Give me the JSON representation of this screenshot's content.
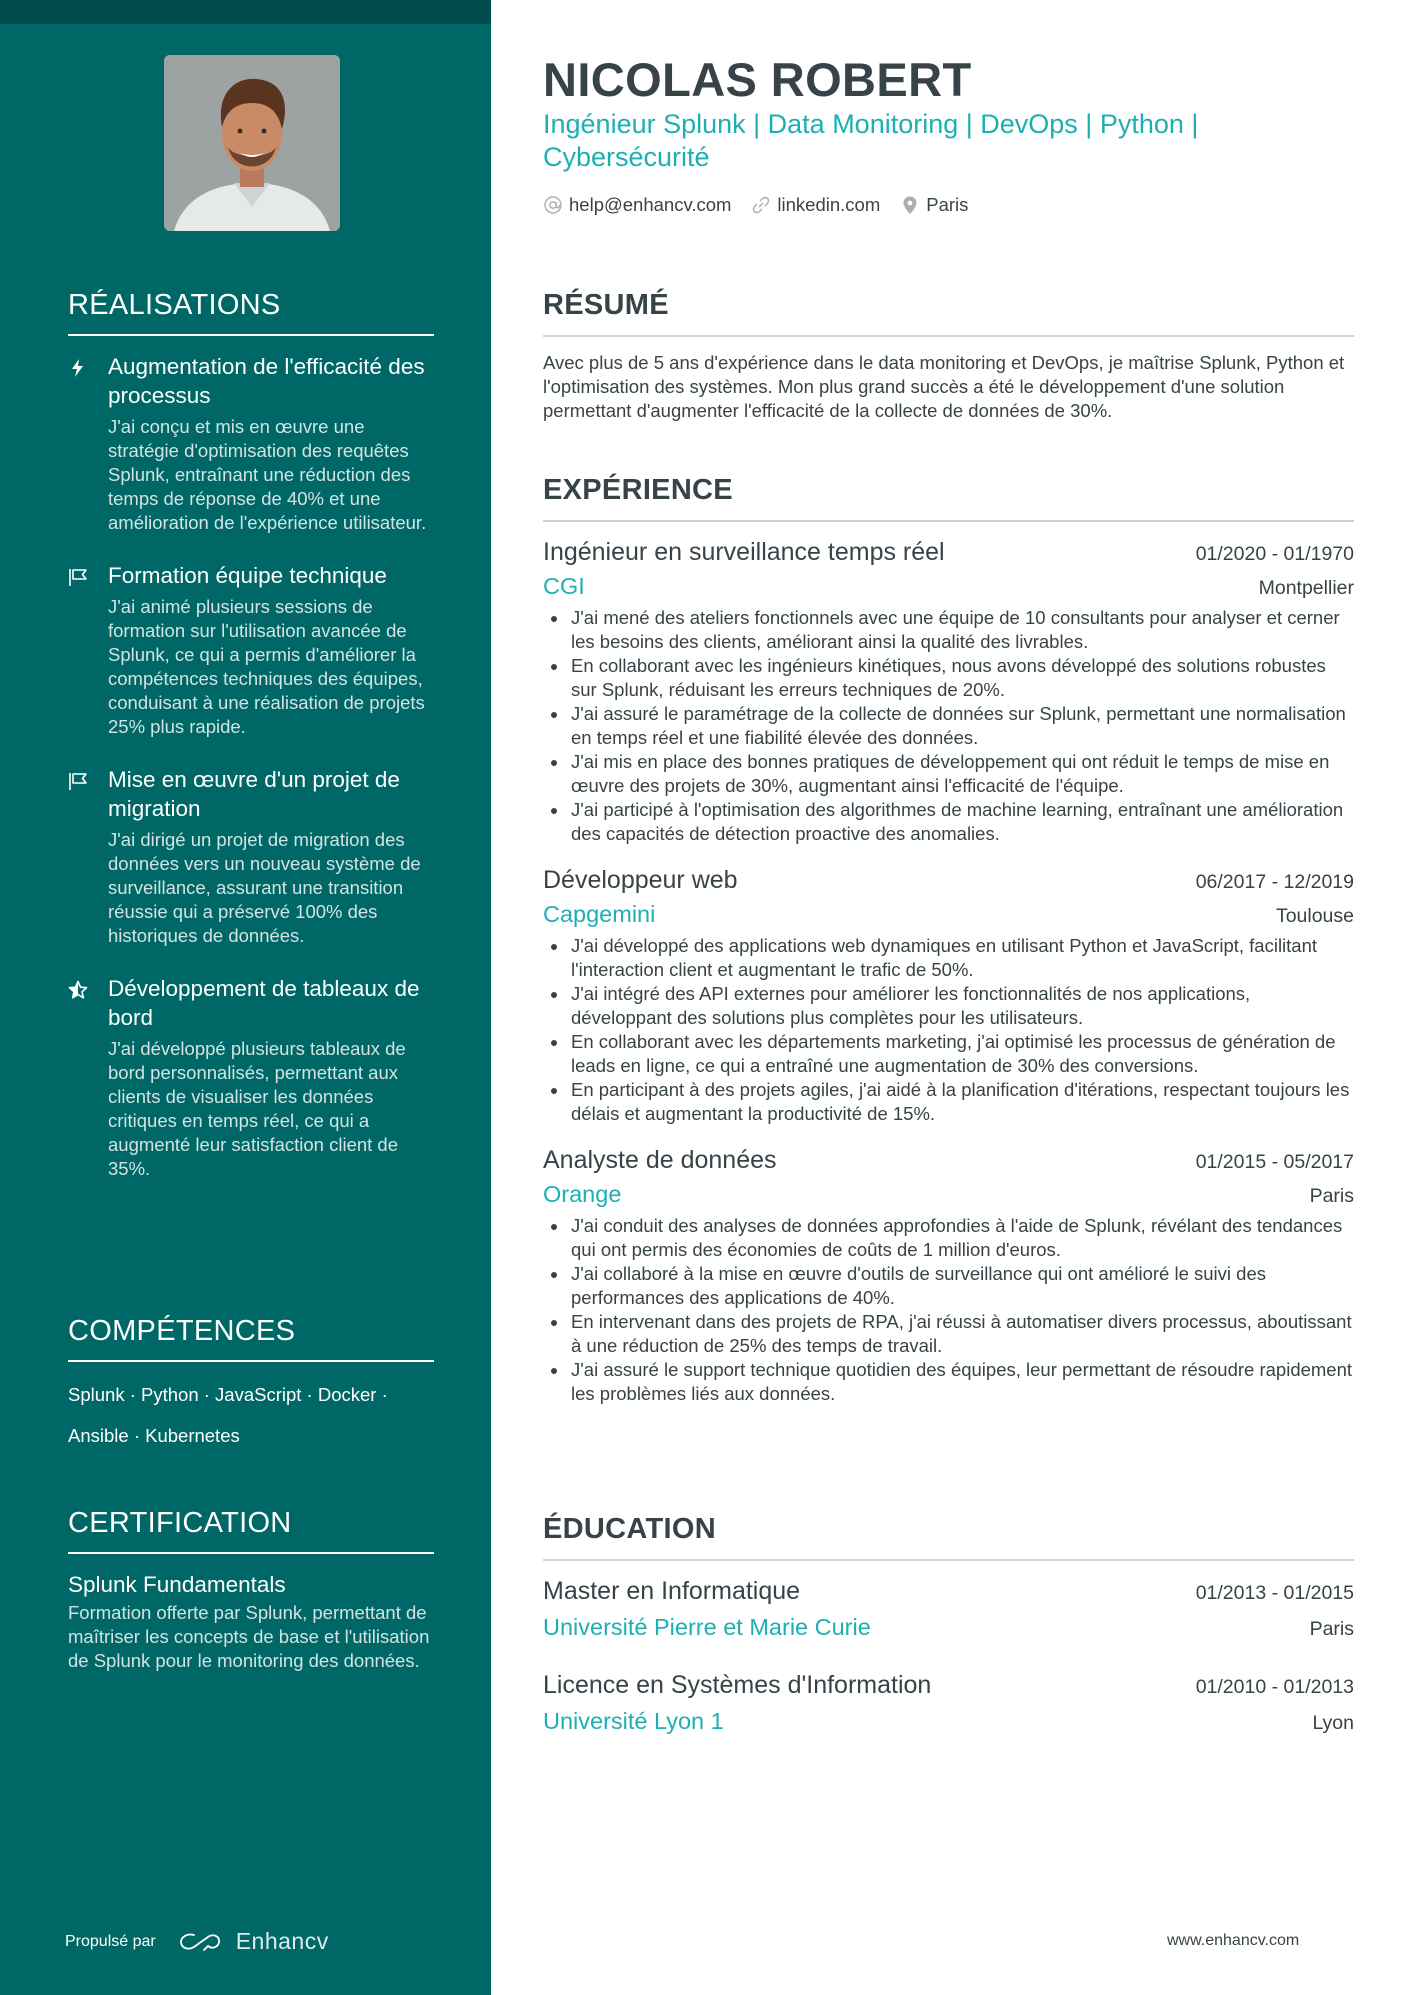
{
  "profile": {
    "name": "NICOLAS ROBERT",
    "headline": "Ingénieur Splunk | Data Monitoring | DevOps | Python | Cybersécurité",
    "contacts": [
      {
        "icon": "at-icon",
        "text": "help@enhancv.com"
      },
      {
        "icon": "link-icon",
        "text": "linkedin.com"
      },
      {
        "icon": "location-pin-icon",
        "text": "Paris"
      }
    ],
    "photo_alt": "Portrait de Nicolas Robert"
  },
  "colors": {
    "sidebar": "#006767",
    "sidebar_top": "#004c4c",
    "accent": "#1dafb2",
    "text": "#384347"
  },
  "sidebar": {
    "achievements": {
      "title": "RÉALISATIONS",
      "items": [
        {
          "icon": "lightning-icon",
          "title": "Augmentation de l'efficacité des processus",
          "desc": "J'ai conçu et mis en œuvre une stratégie d'optimisation des requêtes Splunk, entraînant une réduction des temps de réponse de 40% et une amélioration de l'expérience utilisateur."
        },
        {
          "icon": "flag-icon",
          "title": "Formation équipe technique",
          "desc": "J'ai animé plusieurs sessions de formation sur l'utilisation avancée de Splunk, ce qui a permis d'améliorer la compétences techniques des équipes, conduisant à une réalisation de projets 25% plus rapide."
        },
        {
          "icon": "flag-icon",
          "title": "Mise en œuvre d'un projet de migration",
          "desc": "J'ai dirigé un projet de migration des données vers un nouveau système de surveillance, assurant une transition réussie qui a préservé 100% des historiques de données."
        },
        {
          "icon": "star-icon",
          "title": "Développement de tableaux de bord",
          "desc": "J'ai développé plusieurs tableaux de bord personnalisés, permettant aux clients de visualiser les données critiques en temps réel, ce qui a augmenté leur satisfaction client de 35%."
        }
      ]
    },
    "skills": {
      "title": "COMPÉTENCES",
      "text": "Splunk · Python · JavaScript · Docker · Ansible · Kubernetes"
    },
    "certification": {
      "title": "CERTIFICATION",
      "name": "Splunk Fundamentals",
      "desc": "Formation offerte par Splunk, permettant de maîtriser les concepts de base et l'utilisation de Splunk pour le monitoring des données."
    },
    "powered_by": {
      "label": "Propulsé par",
      "brand": "Enhancv"
    }
  },
  "main": {
    "summary": {
      "title": "RÉSUMÉ",
      "text": "Avec plus de 5 ans d'expérience dans le data monitoring et DevOps, je maîtrise Splunk, Python et l'optimisation des systèmes. Mon plus grand succès a été le développement d'une solution permettant d'augmenter l'efficacité de la collecte de données de 30%."
    },
    "experience": {
      "title": "EXPÉRIENCE",
      "jobs": [
        {
          "title": "Ingénieur en surveillance temps réel",
          "dates": "01/2020 - 01/1970",
          "company": "CGI",
          "location": "Montpellier",
          "bullets": [
            "J'ai mené des ateliers fonctionnels avec une équipe de 10 consultants pour analyser et cerner les besoins des clients, améliorant ainsi la qualité des livrables.",
            "En collaborant avec les ingénieurs kinétiques, nous avons développé des solutions robustes sur Splunk, réduisant les erreurs techniques de 20%.",
            "J'ai assuré le paramétrage de la collecte de données sur Splunk, permettant une normalisation en temps réel et une fiabilité élevée des données.",
            "J'ai mis en place des bonnes pratiques de développement qui ont réduit le temps de mise en œuvre des projets de 30%, augmentant ainsi l'efficacité de l'équipe.",
            "J'ai participé à l'optimisation des algorithmes de machine learning, entraînant une amélioration des capacités de détection proactive des anomalies."
          ]
        },
        {
          "title": "Développeur web",
          "dates": "06/2017 - 12/2019",
          "company": "Capgemini",
          "location": "Toulouse",
          "bullets": [
            "J'ai développé des applications web dynamiques en utilisant Python et JavaScript, facilitant l'interaction client et augmentant le trafic de 50%.",
            "J'ai intégré des API externes pour améliorer les fonctionnalités de nos applications, développant des solutions plus complètes pour les utilisateurs.",
            "En collaborant avec les départements marketing, j'ai optimisé les processus de génération de leads en ligne, ce qui a entraîné une augmentation de 30% des conversions.",
            "En participant à des projets agiles, j'ai aidé à la planification d'itérations, respectant toujours les délais et augmentant la productivité de 15%."
          ]
        },
        {
          "title": "Analyste de données",
          "dates": "01/2015 - 05/2017",
          "company": "Orange",
          "location": "Paris",
          "bullets": [
            "J'ai conduit des analyses de données approfondies à l'aide de Splunk, révélant des tendances qui ont permis des économies de coûts de 1 million d'euros.",
            "J'ai collaboré à la mise en œuvre d'outils de surveillance qui ont amélioré le suivi des performances des applications de 40%.",
            "En intervenant dans des projets de RPA, j'ai réussi à automatiser divers processus, aboutissant à une réduction de 25% des temps de travail.",
            "J'ai assuré le support technique quotidien des équipes, leur permettant de résoudre rapidement les problèmes liés aux données."
          ]
        }
      ]
    },
    "education": {
      "title": "ÉDUCATION",
      "items": [
        {
          "degree": "Master en Informatique",
          "dates": "01/2013 - 01/2015",
          "school": "Université Pierre et Marie Curie",
          "location": "Paris"
        },
        {
          "degree": "Licence en Systèmes d'Information",
          "dates": "01/2010 - 01/2013",
          "school": "Université Lyon 1",
          "location": "Lyon"
        }
      ]
    }
  },
  "footer": {
    "url": "www.enhancv.com"
  }
}
